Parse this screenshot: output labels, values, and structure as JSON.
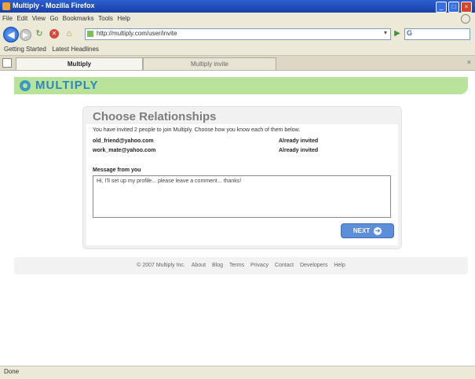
{
  "window": {
    "title": "Multiply - Mozilla Firefox"
  },
  "menu": [
    "File",
    "Edit",
    "View",
    "Go",
    "Bookmarks",
    "Tools",
    "Help"
  ],
  "nav": {
    "url": "http://multiply.com/user/invite"
  },
  "bookmarks": [
    "Getting Started",
    "Latest Headlines"
  ],
  "tabs": [
    {
      "label": "Multiply",
      "active": true
    },
    {
      "label": "Multiply invite",
      "active": false
    }
  ],
  "brand": {
    "logo_text": "MULTIPLY",
    "accent": "#b9e39b",
    "logo_color": "#2f86b8"
  },
  "card": {
    "title": "Choose Relationships",
    "description": "You have invited 2 people to join Multiply. Choose how you know each of them below.",
    "contacts": [
      {
        "email": "old_friend@yahoo.com",
        "status": "Already invited"
      },
      {
        "email": "work_mate@yahoo.com",
        "status": "Already invited"
      }
    ],
    "message_label": "Message from you",
    "message_text": "Hi, I'll set up my profile... please leave a comment... thanks!",
    "next_label": "NEXT"
  },
  "footer": {
    "links": [
      "© 2007 Multiply Inc.",
      "About",
      "Blog",
      "Terms",
      "Privacy",
      "Contact",
      "Developers",
      "Help"
    ]
  },
  "status": {
    "text": "Done"
  }
}
